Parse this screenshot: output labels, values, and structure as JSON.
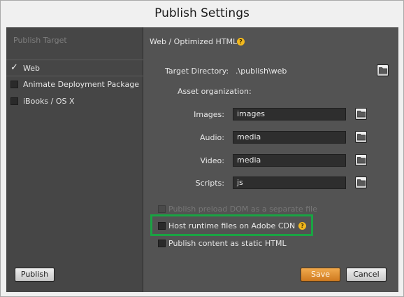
{
  "window": {
    "title": "Publish Settings"
  },
  "publish_target": {
    "header": "Publish Target",
    "items": [
      {
        "label": "Web",
        "checked": true
      },
      {
        "label": "Animate Deployment Package",
        "checked": false
      },
      {
        "label": "iBooks / OS X",
        "checked": false
      }
    ],
    "publish_button": "Publish"
  },
  "settings": {
    "section_title": "Web / Optimized HTML",
    "target_directory_label": "Target Directory:",
    "target_directory_value": ".\\publish\\web",
    "asset_org_label": "Asset organization:",
    "assets": [
      {
        "label": "Images:",
        "value": "images"
      },
      {
        "label": "Audio:",
        "value": "media"
      },
      {
        "label": "Video:",
        "value": "media"
      },
      {
        "label": "Scripts:",
        "value": "js"
      }
    ],
    "options": [
      {
        "label": "Publish preload DOM as a separate file",
        "checked": false,
        "enabled": false
      },
      {
        "label": "Host runtime files on Adobe CDN",
        "checked": false,
        "enabled": true
      },
      {
        "label": "Publish content as static HTML",
        "checked": false,
        "enabled": true
      }
    ],
    "save_button": "Save",
    "cancel_button": "Cancel"
  },
  "icons": {
    "help": "help-icon",
    "folder": "folder-icon",
    "checkmark": "checkmark-icon"
  },
  "colors": {
    "accent": "#e08c2c",
    "help": "#f2b81d",
    "highlight": "#1aa343",
    "panel_bg": "#535353",
    "left_panel_bg": "#464646"
  }
}
